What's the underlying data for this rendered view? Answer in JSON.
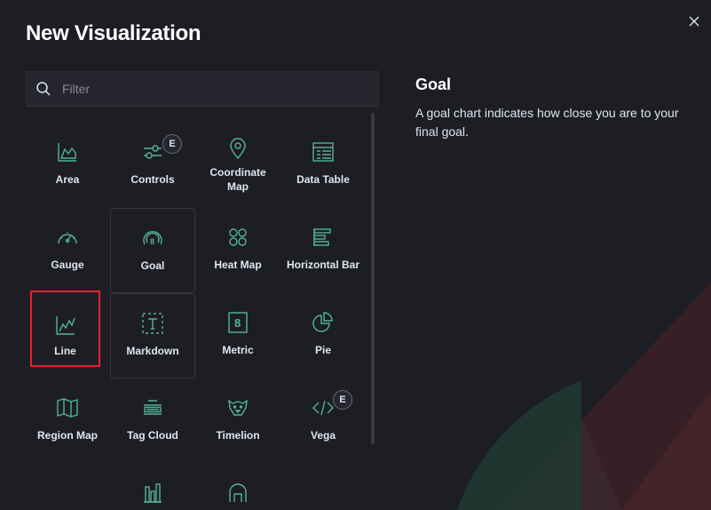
{
  "modal": {
    "title": "New Visualization",
    "close_icon": "close-icon",
    "accent": "#54b399",
    "selection_color": "#e5202a"
  },
  "filter": {
    "placeholder": "Filter",
    "value": "",
    "icon": "search-icon"
  },
  "types": [
    {
      "label": "Area",
      "icon": "area-chart-icon"
    },
    {
      "label": "Controls",
      "icon": "controls-icon",
      "badge": "E"
    },
    {
      "label": "Coordinate Map",
      "icon": "map-pin-icon"
    },
    {
      "label": "Data Table",
      "icon": "table-icon"
    },
    {
      "label": "Gauge",
      "icon": "gauge-icon"
    },
    {
      "label": "Goal",
      "icon": "goal-icon"
    },
    {
      "label": "Heat Map",
      "icon": "heatmap-icon"
    },
    {
      "label": "Horizontal Bar",
      "icon": "horizontal-bar-icon"
    },
    {
      "label": "Line",
      "icon": "line-chart-icon",
      "selected": true
    },
    {
      "label": "Markdown",
      "icon": "markdown-icon"
    },
    {
      "label": "Metric",
      "icon": "metric-icon"
    },
    {
      "label": "Pie",
      "icon": "pie-chart-icon"
    },
    {
      "label": "Region Map",
      "icon": "region-map-icon"
    },
    {
      "label": "Tag Cloud",
      "icon": "tag-cloud-icon"
    },
    {
      "label": "Timelion",
      "icon": "timelion-icon"
    },
    {
      "label": "Vega",
      "icon": "code-icon",
      "badge": "E"
    },
    {
      "label": "",
      "icon": "vertical-bar-icon"
    },
    {
      "label": "",
      "icon": "visual-builder-icon"
    }
  ],
  "description": {
    "title": "Goal",
    "body": "A goal chart indicates how close you are to your final goal."
  }
}
